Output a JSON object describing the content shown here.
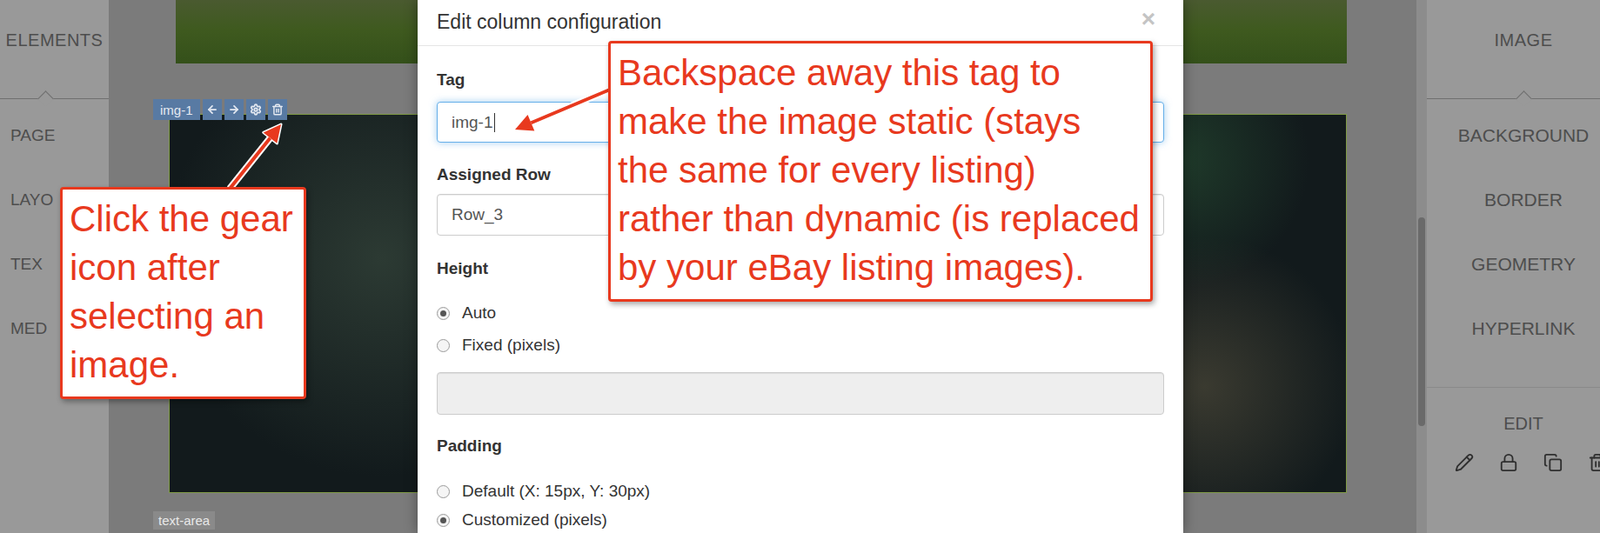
{
  "left_panel": {
    "title": "ELEMENTS",
    "items": [
      "PAGE",
      "LAYO",
      "TEX",
      "MED"
    ]
  },
  "canvas": {
    "selected_tag": "img-1",
    "next_label": "text-area"
  },
  "dialog": {
    "title": "Edit column configuration",
    "close": "×",
    "tag": {
      "label": "Tag",
      "value": "img-1",
      "focused": true
    },
    "assigned_row": {
      "label": "Assigned Row",
      "value": "Row_3"
    },
    "height": {
      "label": "Height",
      "options": [
        {
          "label": "Auto",
          "selected": true
        },
        {
          "label": "Fixed (pixels)",
          "selected": false
        }
      ],
      "value": "",
      "disabled": true
    },
    "padding": {
      "label": "Padding",
      "options": [
        {
          "label": "Default (X: 15px, Y: 30px)",
          "selected": false
        },
        {
          "label": "Customized (pixels)",
          "selected": true
        }
      ]
    }
  },
  "right_panel": {
    "title": "IMAGE",
    "items": [
      "BACKGROUND",
      "BORDER",
      "GEOMETRY",
      "HYPERLINK"
    ],
    "edit": {
      "label": "EDIT"
    }
  },
  "callouts": [
    {
      "lines": [
        "Backspace away this tag to",
        "make the image static (stays",
        "the same for every listing)",
        "rather than dynamic (is replaced",
        "by your eBay listing images)."
      ]
    },
    {
      "lines": [
        "Click the gear",
        "icon after",
        "selecting an",
        "image."
      ]
    }
  ]
}
